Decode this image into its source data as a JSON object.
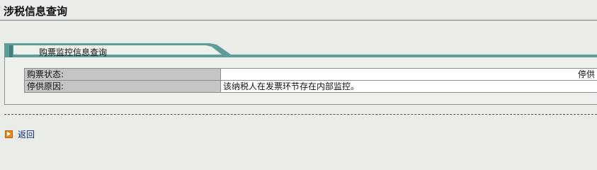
{
  "header": {
    "title": "涉税信息查询"
  },
  "panel": {
    "tab_label": "购票监控信息查询",
    "rows": [
      {
        "label": "购票状态:",
        "value": "停供"
      },
      {
        "label": "停供原因:",
        "value": "该纳税人在发票环节存在内部监控。"
      }
    ]
  },
  "footer": {
    "back_label": "返回"
  },
  "colors": {
    "tab_accent": "#5d9c98",
    "background": "#e9ece7",
    "label_cell": "#c4c6c4",
    "link": "#0a2a7a",
    "back_icon": "#e8871e"
  },
  "icons": {
    "back": "arrow-right-icon"
  }
}
